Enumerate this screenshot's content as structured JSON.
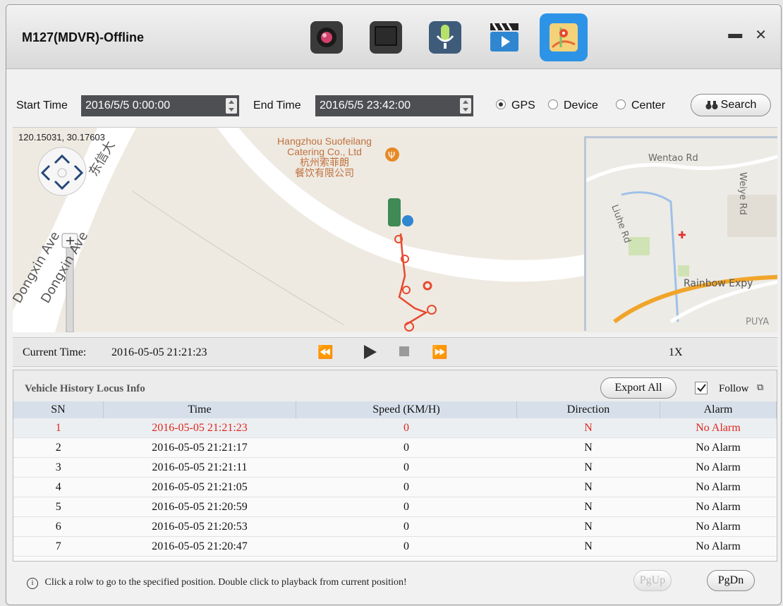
{
  "window": {
    "title": "M127(MDVR)-Offline",
    "minimize_glyph": "▬",
    "close_glyph": "✕"
  },
  "toolbar_icons": [
    "camera-icon",
    "monitor-icon",
    "microphone-icon",
    "video-playback-icon",
    "map-track-icon"
  ],
  "query": {
    "start_label": "Start Time",
    "start_value": "2016/5/5 0:00:00",
    "end_label": "End Time",
    "end_value": "2016/5/5 23:42:00",
    "source_options": [
      "GPS",
      "Device",
      "Center"
    ],
    "selected_source": "GPS",
    "search_label": "Search"
  },
  "map": {
    "coordinates": "120.15031, 30.17603",
    "poi_name_en": "Hangzhou Suofeilang Catering Co., Ltd",
    "poi_name_cn_1": "杭州索菲朗",
    "poi_name_cn_2": "餐饮有限公司",
    "road_1": "Dongxin Ave",
    "road_2": "Dongxin Ave",
    "road_cn": "东信大",
    "inset_roads": [
      "Wentao Rd",
      "Weiye Rd",
      "Liuhe Rd",
      "Rainbow Expy",
      "PUYA"
    ]
  },
  "playback": {
    "current_time_label": "Current Time:",
    "current_time_value": "2016-05-05 21:21:23",
    "speed": "1X"
  },
  "history": {
    "title": "Vehicle History Locus Info",
    "export_label": "Export All",
    "follow_label": "Follow",
    "follow_checked": true,
    "columns": [
      "SN",
      "Time",
      "Speed (KM/H)",
      "Direction",
      "Alarm"
    ],
    "rows": [
      {
        "sn": "1",
        "time": "2016-05-05 21:21:23",
        "speed": "0",
        "direction": "N",
        "alarm": "No Alarm"
      },
      {
        "sn": "2",
        "time": "2016-05-05 21:21:17",
        "speed": "0",
        "direction": "N",
        "alarm": "No Alarm"
      },
      {
        "sn": "3",
        "time": "2016-05-05 21:21:11",
        "speed": "0",
        "direction": "N",
        "alarm": "No Alarm"
      },
      {
        "sn": "4",
        "time": "2016-05-05 21:21:05",
        "speed": "0",
        "direction": "N",
        "alarm": "No Alarm"
      },
      {
        "sn": "5",
        "time": "2016-05-05 21:20:59",
        "speed": "0",
        "direction": "N",
        "alarm": "No Alarm"
      },
      {
        "sn": "6",
        "time": "2016-05-05 21:20:53",
        "speed": "0",
        "direction": "N",
        "alarm": "No Alarm"
      },
      {
        "sn": "7",
        "time": "2016-05-05 21:20:47",
        "speed": "0",
        "direction": "N",
        "alarm": "No Alarm"
      }
    ],
    "selected_row": 0
  },
  "footer": {
    "info_text": "Click a rolw to go to the specified position. Double click to playback from current position!",
    "pgup_label": "PgUp",
    "pgdn_label": "PgDn"
  },
  "colors": {
    "accent": "#2d93e6",
    "selected_row_text": "#e0261c",
    "track": "#e84a2f",
    "field_bg": "#4e4f52"
  }
}
